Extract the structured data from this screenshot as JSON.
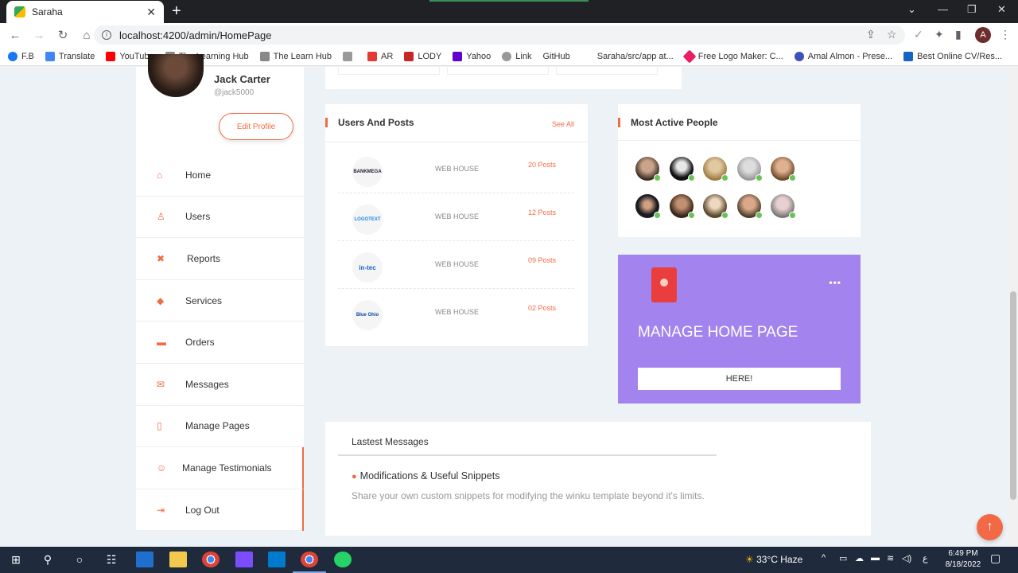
{
  "browser": {
    "tab_title": "Saraha",
    "url": "localhost:4200/admin/HomePage",
    "profile_initial": "A",
    "bookmarks": [
      "F.B",
      "Translate",
      "YouTube",
      "The Learning Hub",
      "The Learn Hub",
      "",
      "AR",
      "LODY",
      "Yahoo",
      "Link",
      "GitHub",
      "Saraha/src/app at...",
      "Free Logo Maker: C...",
      "Amal Almon - Prese...",
      "Best Online CV/Res..."
    ]
  },
  "profile": {
    "name": "Jack Carter",
    "handle": "@jack5000",
    "edit_label": "Edit Profile"
  },
  "menu": [
    {
      "label": "Home",
      "icon": "home-icon",
      "glyph": "⌂"
    },
    {
      "label": "Users",
      "icon": "user-icon",
      "glyph": "♙"
    },
    {
      "label": "Reports",
      "icon": "user-x-icon",
      "glyph": "✖"
    },
    {
      "label": "Services",
      "icon": "tag-icon",
      "glyph": "◆"
    },
    {
      "label": "Orders",
      "icon": "cart-icon",
      "glyph": "▬"
    },
    {
      "label": "Messages",
      "icon": "envelope-icon",
      "glyph": "✉"
    },
    {
      "label": "Manage Pages",
      "icon": "columns-icon",
      "glyph": "▯"
    },
    {
      "label": "Manage Testimonials",
      "icon": "smile-icon",
      "glyph": "☺"
    },
    {
      "label": "Log Out",
      "icon": "logout-icon",
      "glyph": "⇥"
    }
  ],
  "users_posts": {
    "title": "Users And Posts",
    "see_all": "See All",
    "rows": [
      {
        "logo": "BANKMEGA",
        "house": "WEB HOUSE",
        "posts": "20 Posts"
      },
      {
        "logo": "LOGOTEXT",
        "house": "WEB HOUSE",
        "posts": "12 Posts"
      },
      {
        "logo": "in-tec",
        "house": "WEB HOUSE",
        "posts": "09 Posts"
      },
      {
        "logo": "Blue Ohio",
        "house": "WEB HOUSE",
        "posts": "02 Posts"
      }
    ]
  },
  "active_people": {
    "title": "Most Active People",
    "count": 10
  },
  "manage_card": {
    "title": "MANAGE HOME PAGE",
    "button": "HERE!"
  },
  "latest_messages": {
    "title": "Lastest Messages",
    "subject": "Modifications & Useful Snippets",
    "body": "Share your own custom snippets for modifying the winku template beyond it's limits."
  },
  "taskbar": {
    "weather": "33°C  Haze",
    "time": "6:49 PM",
    "date": "8/18/2022",
    "lang": "ع"
  },
  "colors": {
    "accent": "#f16b45",
    "purple_card": "#a383ee",
    "online": "#6ac259"
  }
}
